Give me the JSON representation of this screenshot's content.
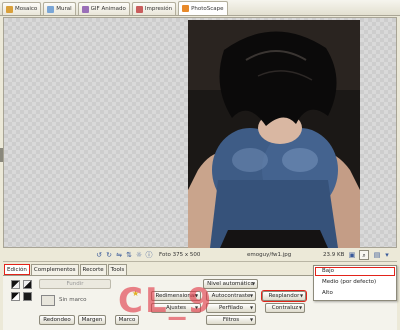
{
  "top_tabs": [
    {
      "label": "Mosaico",
      "icon": "mosaic-icon",
      "color": "#d9a03a"
    },
    {
      "label": "Mural",
      "icon": "mural-icon",
      "color": "#7aa6d6"
    },
    {
      "label": "GIF Animado",
      "icon": "gif-icon",
      "color": "#9a6fb8"
    },
    {
      "label": "Impresión",
      "icon": "print-icon",
      "color": "#c95d5d"
    },
    {
      "label": "PhotoScape",
      "icon": "photoscape-icon",
      "color": "#e88a2a"
    }
  ],
  "status": {
    "photo_info": "Foto 375 x 500",
    "file_name": "emoguy/fw1.jpg",
    "file_size": "23.9 KB"
  },
  "editor_tabs": [
    "Edición",
    "Complementos",
    "Recorte",
    "Tools"
  ],
  "panel": {
    "fundir_label": "Fundir",
    "marco_placeholder": "Sin marco",
    "redondeo_label": "Redondeo",
    "margen_label": "Margen",
    "marco_label": "Marco",
    "redimensionar_label": "Redimensionar",
    "ajustes_label": "Ajustes",
    "autocontraste_label": "Autocontraste",
    "perfilado_label": "Perfilado",
    "filtros_label": "Filtros",
    "nivel_label": "Nivel automático",
    "resplandor_label": "Resplandor",
    "contraluz_label": "Contraluz"
  },
  "resplandor_menu": {
    "items": [
      "Bajo",
      "Medio (por defecto)",
      "Alto"
    ],
    "selected_index": 0
  },
  "watermark": "CL_9",
  "colors": {
    "highlight": "#e2231a",
    "watermark": "#e13746",
    "background": "#ece9d8"
  }
}
